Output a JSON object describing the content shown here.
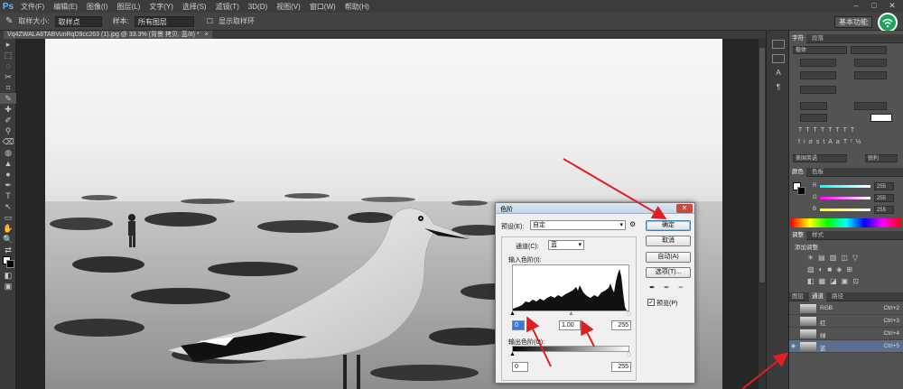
{
  "app": {
    "logo": "Ps"
  },
  "menu": [
    "文件(F)",
    "编辑(E)",
    "图像(I)",
    "图层(L)",
    "文字(Y)",
    "选择(S)",
    "滤镜(T)",
    "3D(D)",
    "视图(V)",
    "窗口(W)",
    "帮助(H)"
  ],
  "window_controls": [
    "–",
    "□",
    "✕"
  ],
  "options_bar": {
    "sample_size_label": "取样大小:",
    "sample_size_value": "取样点",
    "sample_label": "样本:",
    "sample_value": "所有图层",
    "show_ring_label": "显示取样环",
    "workspace": "基本功能"
  },
  "document": {
    "tab_title": "Vq4ZWALA6TABVunRqD9cc263 (1).jpg @ 33.3% (背景 拷贝, 蓝/8) *",
    "close": "×"
  },
  "tools": [
    "▸",
    "⬚",
    "◌",
    "✂",
    "⌗",
    "✎",
    "✚",
    "✐",
    "⚲",
    "⌫",
    "◍",
    "▲",
    "●",
    "✒",
    "T",
    "↖",
    "▭",
    "✋",
    "🔍",
    "⇄",
    "◧",
    "▣"
  ],
  "levels_dialog": {
    "title": "色阶",
    "preset_label": "预设(E):",
    "preset_value": "自定",
    "channel_label": "通道(C):",
    "channel_value": "蓝",
    "input_levels_label": "输入色阶(I):",
    "input_black": "0",
    "input_gamma": "1.00",
    "input_white": "255",
    "output_levels_label": "输出色阶(O):",
    "output_black": "0",
    "output_white": "255",
    "ok": "确定",
    "cancel": "取消",
    "auto": "自动(A)",
    "options": "选项(T)...",
    "preview_label": "预览(P)",
    "preview_checked": true
  },
  "panels": {
    "char_tabs": [
      "字符",
      "段落"
    ],
    "char_font": "楷体",
    "char_size": "",
    "char_lang": "美国英语",
    "char_aa": "锐利",
    "color_label": "颜色(C):",
    "color_tabs": [
      "颜色",
      "色板"
    ],
    "color_sliders": [
      {
        "label": "R",
        "value": "255",
        "color": "#e04a4a"
      },
      {
        "label": "G",
        "value": "255",
        "color": "#4ad04a"
      },
      {
        "label": "B",
        "value": "255",
        "color": "#4a6ae0"
      }
    ],
    "adjust_tabs": [
      "调整",
      "样式"
    ],
    "adjust_label": "添加调整",
    "layer_tabs": [
      "图层",
      "通道",
      "路径"
    ],
    "channels": [
      {
        "name": "RGB",
        "key": "Ctrl+2"
      },
      {
        "name": "红",
        "key": "Ctrl+3"
      },
      {
        "name": "绿",
        "key": "Ctrl+4"
      },
      {
        "name": "蓝",
        "key": "Ctrl+5"
      }
    ]
  },
  "colors": {
    "accent_arrow": "#e02020",
    "selected_channel": "#5a6f8f"
  }
}
